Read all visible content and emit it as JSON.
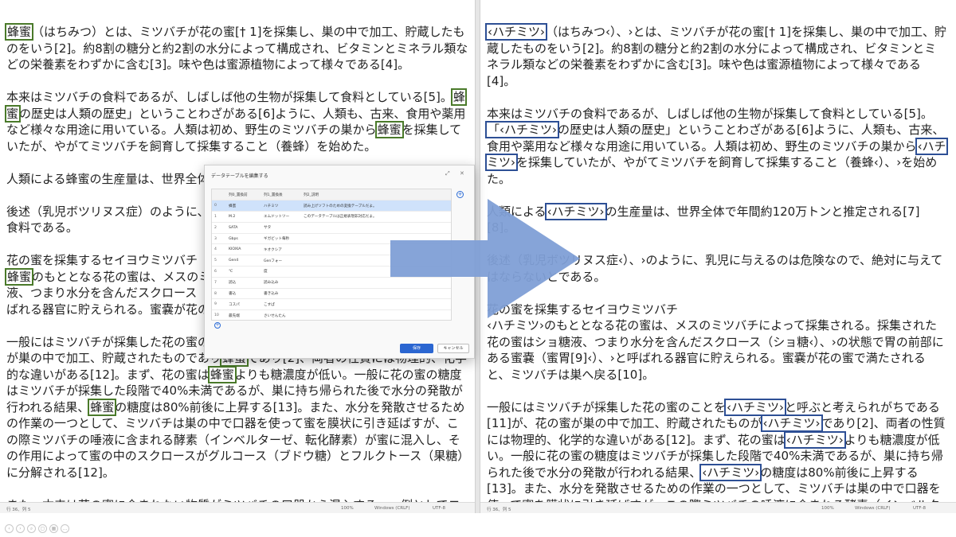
{
  "left": {
    "paragraphs": [
      {
        "parts": [
          {
            "hl": "蜂蜜"
          },
          {
            "t": "（はちみつ）とは、ミツバチが花の蜜[† 1]を採集し、巣の中で加工、貯蔵したものをいう[2]。約8割の糖分と約2割の水分によって構成され、ビタミンとミネラル類などの栄養素をわずかに含む[3]。味や色は蜜源植物によって様々である[4]。"
          }
        ]
      },
      {
        "parts": [
          {
            "t": "本来はミツバチの食料であるが、しばしば他の生物が採集して食料としている[5]。"
          },
          {
            "hl": "蜂蜜"
          },
          {
            "t": "の歴史は人類の歴史」ということわざがある[6]ように、人類も、古来、食用や薬用など様々な用途に用いている。人類は初め、野生のミツバチの巣から"
          },
          {
            "hl": "蜂蜜"
          },
          {
            "t": "を採集していたが、やがてミツバチを飼育して採集すること（養蜂）を始めた。"
          }
        ]
      },
      {
        "parts": [
          {
            "t": "人類による蜂蜜の生産量は、世界全体で"
          }
        ]
      },
      {
        "parts": [
          {
            "t": "後述（乳児ボツリヌス症）のように、乳"
          },
          {
            "br": true
          },
          {
            "t": "食料である。"
          }
        ]
      },
      {
        "tight": true,
        "parts": [
          {
            "t": "花の蜜を採集するセイヨウミツバチ"
          }
        ]
      },
      {
        "parts": [
          {
            "hl": "蜂蜜"
          },
          {
            "t": "のもととなる花の蜜は、メスのミツ"
          },
          {
            "br": true
          },
          {
            "t": "液、つまり水分を含んだスクロース（シ"
          },
          {
            "br": true
          },
          {
            "t": "ばれる器官に貯えられる。蜜嚢が花の蜜"
          }
        ]
      },
      {
        "parts": [
          {
            "t": "一般にはミツバチが採集した花の蜜のこ"
          },
          {
            "br": true
          },
          {
            "t": "が巣の中で加工、貯蔵されたものであり"
          },
          {
            "hl": "蜂蜜"
          },
          {
            "t": "であり[2]、両者の性質には物理的、化学的な違いがある[12]。まず、花の蜜は"
          },
          {
            "hl": "蜂蜜"
          },
          {
            "t": "よりも糖濃度が低い。一般に花の蜜の糖度はミツバチが採集した段階で40%未満であるが、巣に持ち帰られた後で水分の発散が行われる結果、"
          },
          {
            "hl": "蜂蜜"
          },
          {
            "t": "の糖度は80%前後に上昇する[13]。また、水分を発散させるための作業の一つとして、ミツバチは巣の中で口器を使って蜜を膜状に引き延ばすが、この際ミツバチの唾液に含まれる酵素（インベルターゼ、転化酵素）が蜜に混入し、その作用によって蜜の中のスクロースがグルコース（ブドウ糖）とフルクトース（果糖）に分解される[12]。"
          }
        ]
      },
      {
        "parts": [
          {
            "t": "また、本来は花の蜜に含まれない物質がミツバチの口器から混入する。一例としてコリンが挙"
          }
        ]
      }
    ],
    "status": {
      "pos": "行 36、列 5",
      "zoom": "100%",
      "eol": "Windows (CRLF)",
      "encoding": "UTF-8"
    }
  },
  "right": {
    "paragraphs": [
      {
        "parts": [
          {
            "hl": "‹ハチミツ›"
          },
          {
            "t": "（はちみつ‹）、›とは、ミツバチが花の蜜[† 1]を採集し、巣の中で加工、貯蔵したものをいう[2]。約8割の糖分と約2割の水分によって構成され、ビタミンとミネラル類などの栄養素をわずかに含む[3]。味や色は蜜源植物によって様々である[4]。"
          }
        ]
      },
      {
        "parts": [
          {
            "t": "本来はミツバチの食料であるが、しばしば他の生物が採集して食料としている[5]。"
          },
          {
            "hl": "「‹ハチミツ›"
          },
          {
            "t": "の歴史は人類の歴史」ということわざがある[6]ように、人類も、古来、食用や薬用など様々な用途に用いている。人類は初め、野生のミツバチの巣から"
          },
          {
            "hl": "‹ハチミツ›"
          },
          {
            "t": "を採集していたが、やがてミツバチを飼育して採集すること（養蜂‹）、›を始めた。"
          }
        ]
      },
      {
        "parts": [
          {
            "t": "人類による"
          },
          {
            "hl": "‹ハチミツ›"
          },
          {
            "t": "の生産量は、世界全体で年間約120万トンと推定される[7][8]。"
          }
        ]
      },
      {
        "parts": [
          {
            "t": "後述（乳児ボツリヌス症‹）、›のように、乳児に与えるのは危険なので、絶対に与えてはならないと"
          },
          {
            "t": "である。"
          }
        ]
      },
      {
        "tight": true,
        "parts": [
          {
            "t": "花の蜜を採集するセイヨウミツバチ"
          }
        ]
      },
      {
        "parts": [
          {
            "t": "‹ハチミツ›のもととなる花の蜜は、メスのミツバチによって採集される。採集された花の蜜はショ糖液、つまり水分を含んだスクロース（ショ糖‹）、›の状態で胃の前部にある蜜嚢（蜜胃[9]‹）、›と呼ばれる器官に貯えられる。蜜嚢が花の蜜で満たされると、ミツバチは巣へ戻る[10]。"
          }
        ]
      },
      {
        "parts": [
          {
            "t": "一般にはミツバチが採集した花の蜜のことを"
          },
          {
            "hl": "‹ハチミツ›"
          },
          {
            "t": "と呼ぶと考えられがちである[11]が、花の蜜が巣の中で加工、貯蔵されたものが"
          },
          {
            "hl": "‹ハチミツ›"
          },
          {
            "t": "であり[2]、両者の性質には物理的、化学的な違いがある[12]。まず、花の蜜は"
          },
          {
            "hl": "‹ハチミツ›"
          },
          {
            "t": "よりも糖濃度が低い。一般に花の蜜の糖度はミツバチが採集した段階で40%未満であるが、巣に持ち帰られた後で水分の発散が行われる結果、"
          },
          {
            "hl": "‹ハチミツ›"
          },
          {
            "t": "の糖度は80%前後に上昇する[13]。また、水分を発散させるための作業の一つとして、ミツバチは巣の中で口器を使って蜜を膜状に引き延ばすが、この際ミツバチの唾液に含まれる酵素（インベルターゼ、転化酵素‹）、›が蜜に混入し、その作用によって蜜の中のスクロースがグルコース（ブドウ糖‹）、›とフルクトース（果糖‹）、›に分解される[12]。"
          }
        ]
      }
    ],
    "status": {
      "pos": "行 36、列 5",
      "zoom": "100%",
      "eol": "Windows (CRLF)",
      "encoding": "UTF-8"
    }
  },
  "dialog": {
    "title": "データテーブルを編集する",
    "columns": [
      "",
      "列0_置換前",
      "列1_置換後",
      "列2_説明"
    ],
    "rows": [
      [
        "0",
        "蜂蜜",
        "ハチミツ",
        "読み上げソフトのための変換テーブルだよ。"
      ],
      [
        "1",
        "M.2",
        "エムドットツー",
        "このデータテーブルは正規表現非対応だよ。"
      ],
      [
        "2",
        "SATA",
        "サタ",
        ""
      ],
      [
        "3",
        "Gbps",
        "ギガビット毎秒",
        ""
      ],
      [
        "4",
        "KIOXIA",
        "キオクシア",
        ""
      ],
      [
        "5",
        "Gen4",
        "Genフォー",
        ""
      ],
      [
        "6",
        "℃",
        "度",
        ""
      ],
      [
        "7",
        "読込",
        "読み込み",
        ""
      ],
      [
        "8",
        "書込",
        "書き込み",
        ""
      ],
      [
        "9",
        "コスパ",
        "こすぱ",
        ""
      ],
      [
        "10",
        "最先端",
        "さいせんたん",
        ""
      ]
    ],
    "save_label": "保存",
    "cancel_label": "キャンセル",
    "expand_icon": "expand-icon",
    "close_icon": "close-icon",
    "add_icon": "add-icon"
  },
  "colors": {
    "left_highlight": "#4a7a2a",
    "right_highlight": "#2d4f95",
    "arrow": "#7f9fd6",
    "save_button": "#2b66d1"
  },
  "navigation_icons": [
    "previous-icon",
    "next-icon",
    "zoom-icon",
    "copy-icon",
    "grid-icon",
    "more-icon"
  ]
}
